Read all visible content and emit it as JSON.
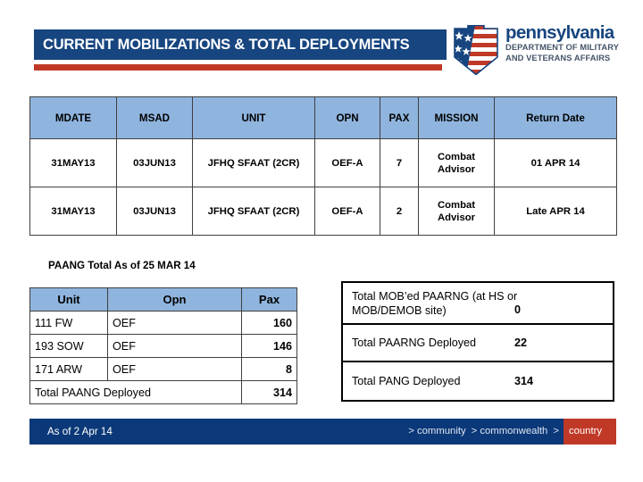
{
  "header": {
    "title": "CURRENT MOBILIZATIONS & TOTAL DEPLOYMENTS",
    "band_color": "#17457f",
    "rule_color": "#bf3926"
  },
  "logo": {
    "icon": "pennsylvania-keystone-flag-icon",
    "wordmark": "pennsylvania",
    "subtitle_line1": "DEPARTMENT OF MILITARY",
    "subtitle_line2": "AND VETERANS AFFAIRS"
  },
  "main_table": {
    "header_color": "#8fb4de",
    "columns": [
      "MDATE",
      "MSAD",
      "UNIT",
      "OPN",
      "PAX",
      "MISSION",
      "Return Date"
    ],
    "rows": [
      {
        "mdate": "31MAY13",
        "msad": "03JUN13",
        "unit": "JFHQ SFAAT (2CR)",
        "opn": "OEF-A",
        "pax": "7",
        "mission": "Combat Advisor",
        "return_date": "01 APR 14"
      },
      {
        "mdate": "31MAY13",
        "msad": "03JUN13",
        "unit": "JFHQ SFAAT (2CR)",
        "opn": "OEF-A",
        "pax": "2",
        "mission": "Combat Advisor",
        "return_date": "Late APR 14"
      }
    ]
  },
  "paang": {
    "caption": "PAANG Total As of 25 MAR 14",
    "columns": [
      "Unit",
      "Opn",
      "Pax"
    ],
    "rows": [
      {
        "unit": "111 FW",
        "opn": "OEF",
        "pax": "160"
      },
      {
        "unit": "193 SOW",
        "opn": "OEF",
        "pax": "146"
      },
      {
        "unit": "171 ARW",
        "opn": "OEF",
        "pax": "8"
      }
    ],
    "total_label": "Total PAANG Deployed",
    "total_value": "314"
  },
  "totals_box": {
    "rows": [
      {
        "label": "Total MOB’ed PAARNG (at HS or\nMOB/DEMOB site)",
        "value": "0"
      },
      {
        "label": "Total PAARNG Deployed",
        "value": "22"
      },
      {
        "label": "Total PANG Deployed",
        "value": "314"
      }
    ]
  },
  "footer": {
    "as_of": "As of  2 Apr 14",
    "crumb_1": "> community",
    "crumb_2": "> commonwealth",
    "crumb_3_sep": ">",
    "crumb_3": "country",
    "bar_color": "#0b3878",
    "accent_color": "#bf3926"
  }
}
